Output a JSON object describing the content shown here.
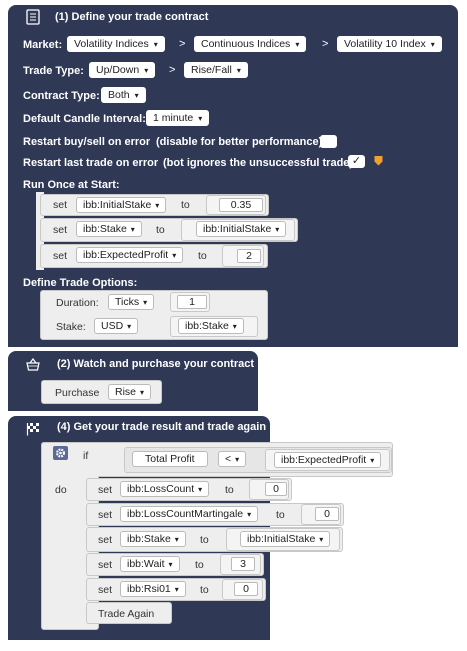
{
  "block1": {
    "title": "(1) Define your trade contract",
    "market_label": "Market:",
    "market": [
      "Volatility Indices",
      "Continuous Indices",
      "Volatility 10 Index"
    ],
    "sep": ">",
    "trade_type_label": "Trade Type:",
    "trade_type": [
      "Up/Down",
      "Rise/Fall"
    ],
    "contract_type_label": "Contract Type:",
    "contract_type": "Both",
    "candle_label": "Default Candle Interval:",
    "candle": "1 minute",
    "restart_error_label": "Restart buy/sell on error",
    "restart_error_note": "(disable for better performance):",
    "restart_last_label": "Restart last trade on error",
    "restart_last_note": "(bot ignores the unsuccessful trade):",
    "checkmark": "✓",
    "run_once_label": "Run Once at Start:",
    "set_word": "set",
    "to_word": "to",
    "rows": [
      {
        "var": "ibb:InitialStake",
        "value": "0.35"
      },
      {
        "var": "ibb:Stake",
        "value_var": "ibb:InitialStake"
      },
      {
        "var": "ibb:ExpectedProfit",
        "value": "2"
      }
    ],
    "options_label": "Define Trade Options:",
    "duration_label": "Duration:",
    "duration_unit": "Ticks",
    "duration_value": "1",
    "stake_label": "Stake:",
    "currency": "USD",
    "stake_var": "ibb:Stake"
  },
  "block2": {
    "title": "(2) Watch and purchase your contract",
    "purchase_label": "Purchase",
    "purchase_type": "Rise"
  },
  "block4": {
    "title": "(4) Get your trade result and trade again",
    "if_word": "if",
    "do_word": "do",
    "condition_left": "Total Profit",
    "condition_op": "<",
    "condition_right": "ibb:ExpectedProfit",
    "set_word": "set",
    "to_word": "to",
    "rows": [
      {
        "var": "ibb:LossCount",
        "value": "0"
      },
      {
        "var": "ibb:LossCountMartingale",
        "value": "0"
      },
      {
        "var": "ibb:Stake",
        "value_var": "ibb:InitialStake"
      },
      {
        "var": "ibb:Wait",
        "value": "3"
      },
      {
        "var": "ibb:Rsi01",
        "value": "0"
      }
    ],
    "trade_again": "Trade Again"
  },
  "colors": {
    "block": "#2f3956",
    "inner": "#eeeeee",
    "mutator": "#5b6a92",
    "warning": "#f0a030"
  },
  "icons": [
    "document-icon",
    "basket-icon",
    "checkered-flag-icon",
    "gear-icon",
    "warning-icon"
  ]
}
